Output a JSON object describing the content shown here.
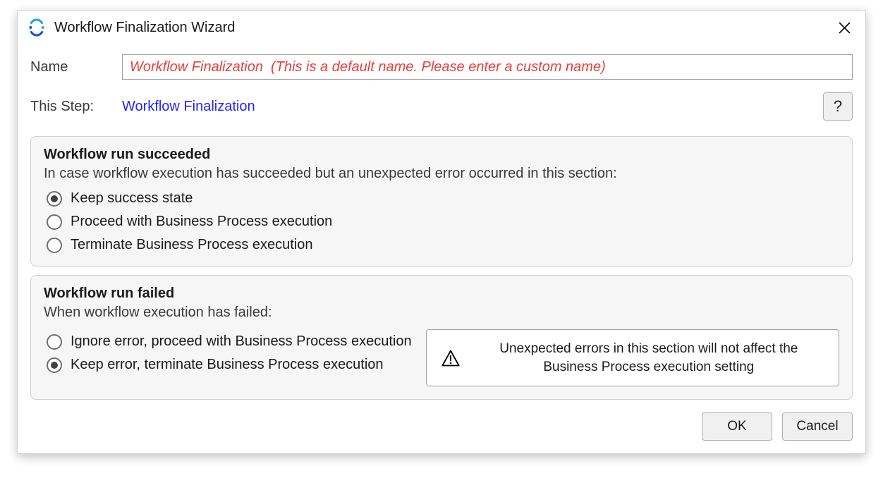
{
  "dialog": {
    "title": "Workflow Finalization Wizard"
  },
  "header": {
    "name_label": "Name",
    "name_value": "Workflow Finalization  (This is a default name. Please enter a custom name)",
    "step_label": "This Step:",
    "step_value": "Workflow Finalization"
  },
  "group_success": {
    "title": "Workflow run succeeded",
    "desc": "In case workflow execution has succeeded but an unexpected error occurred in this section:",
    "options": [
      {
        "label": "Keep success state",
        "checked": true
      },
      {
        "label": "Proceed with Business Process execution",
        "checked": false
      },
      {
        "label": "Terminate Business Process execution",
        "checked": false
      }
    ]
  },
  "group_fail": {
    "title": "Workflow run failed",
    "desc": "When workflow execution has failed:",
    "options": [
      {
        "label": "Ignore error, proceed with Business Process execution",
        "checked": false
      },
      {
        "label": "Keep error, terminate Business Process execution",
        "checked": true
      }
    ],
    "info": "Unexpected errors in this section will not affect the Business Process execution setting"
  },
  "footer": {
    "ok": "OK",
    "cancel": "Cancel"
  }
}
